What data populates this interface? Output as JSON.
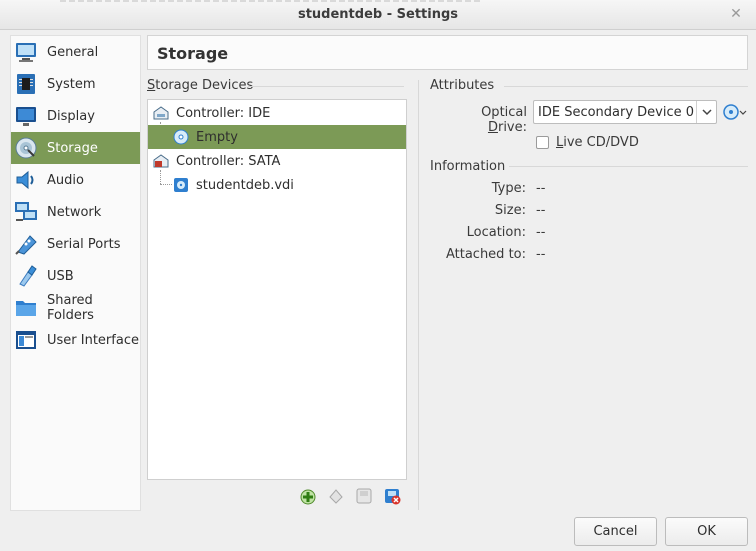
{
  "window": {
    "title": "studentdeb - Settings"
  },
  "sidebar": {
    "items": [
      {
        "label": "General",
        "icon": "general-icon"
      },
      {
        "label": "System",
        "icon": "system-icon"
      },
      {
        "label": "Display",
        "icon": "display-icon"
      },
      {
        "label": "Storage",
        "icon": "storage-icon",
        "active": true
      },
      {
        "label": "Audio",
        "icon": "audio-icon"
      },
      {
        "label": "Network",
        "icon": "network-icon"
      },
      {
        "label": "Serial Ports",
        "icon": "serial-ports-icon"
      },
      {
        "label": "USB",
        "icon": "usb-icon"
      },
      {
        "label": "Shared Folders",
        "icon": "shared-folders-icon"
      },
      {
        "label": "User Interface",
        "icon": "user-interface-icon"
      }
    ]
  },
  "header": {
    "title": "Storage"
  },
  "storage_devices": {
    "label_mnemonic": "S",
    "label_rest": "torage Devices",
    "tree": [
      {
        "label": "Controller: IDE",
        "type": "controller"
      },
      {
        "label": "Empty",
        "type": "optical",
        "selected": true
      },
      {
        "label": "Controller: SATA",
        "type": "controller"
      },
      {
        "label": "studentdeb.vdi",
        "type": "disk"
      }
    ],
    "toolbar": [
      "add-attachment-icon",
      "remove-attachment-icon",
      "add-controller-icon",
      "remove-controller-icon"
    ]
  },
  "attributes": {
    "section_label": "Attributes",
    "optical_drive_label_pre": "Optical ",
    "optical_drive_label_mn": "D",
    "optical_drive_label_post": "rive:",
    "optical_drive_value": "IDE Secondary Device 0",
    "live_cd_mn": "L",
    "live_cd_rest": "ive CD/DVD",
    "live_cd_checked": false
  },
  "information": {
    "section_label": "Information",
    "rows": [
      {
        "label": "Type:",
        "value": "--"
      },
      {
        "label": "Size:",
        "value": "--"
      },
      {
        "label": "Location:",
        "value": "--"
      },
      {
        "label": "Attached to:",
        "value": "--"
      }
    ]
  },
  "buttons": {
    "cancel": "Cancel",
    "ok": "OK"
  },
  "colors": {
    "selection": "#7c9a56",
    "background": "#efefef"
  }
}
